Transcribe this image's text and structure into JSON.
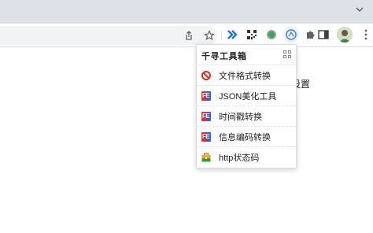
{
  "page": {
    "partial_text": "设置"
  },
  "toolbar": {
    "icons": [
      "share-icon",
      "bookmark-star-icon"
    ],
    "extensions": [
      "double-chevron-extension-icon",
      "qr-code-extension-icon",
      "green-circle-extension-icon",
      "qianxun-toolbox-extension-icon",
      "puzzle-extensions-icon"
    ],
    "side_panel_icon": "side-panel-icon",
    "menu_icon": "kebab-menu-icon"
  },
  "popup": {
    "title": "千寻工具箱",
    "header_icon": "grid-icon",
    "items": [
      {
        "label": "文件格式转换",
        "icon": "no-sign-icon"
      },
      {
        "label": "JSON美化工具",
        "icon": "fe-icon"
      },
      {
        "label": "时间戳转换",
        "icon": "fe-icon"
      },
      {
        "label": "信息编码转换",
        "icon": "fe-icon"
      },
      {
        "label": "http状态码",
        "icon": "toolbox-icon"
      }
    ]
  },
  "colors": {
    "tabstrip": "#dee1e6",
    "omnibox": "#f1f3f4",
    "extension_blue": "#1a73e8",
    "no_sign_red": "#d93025",
    "fe_red": "#e03131",
    "fe_blue": "#3b5bdb"
  }
}
